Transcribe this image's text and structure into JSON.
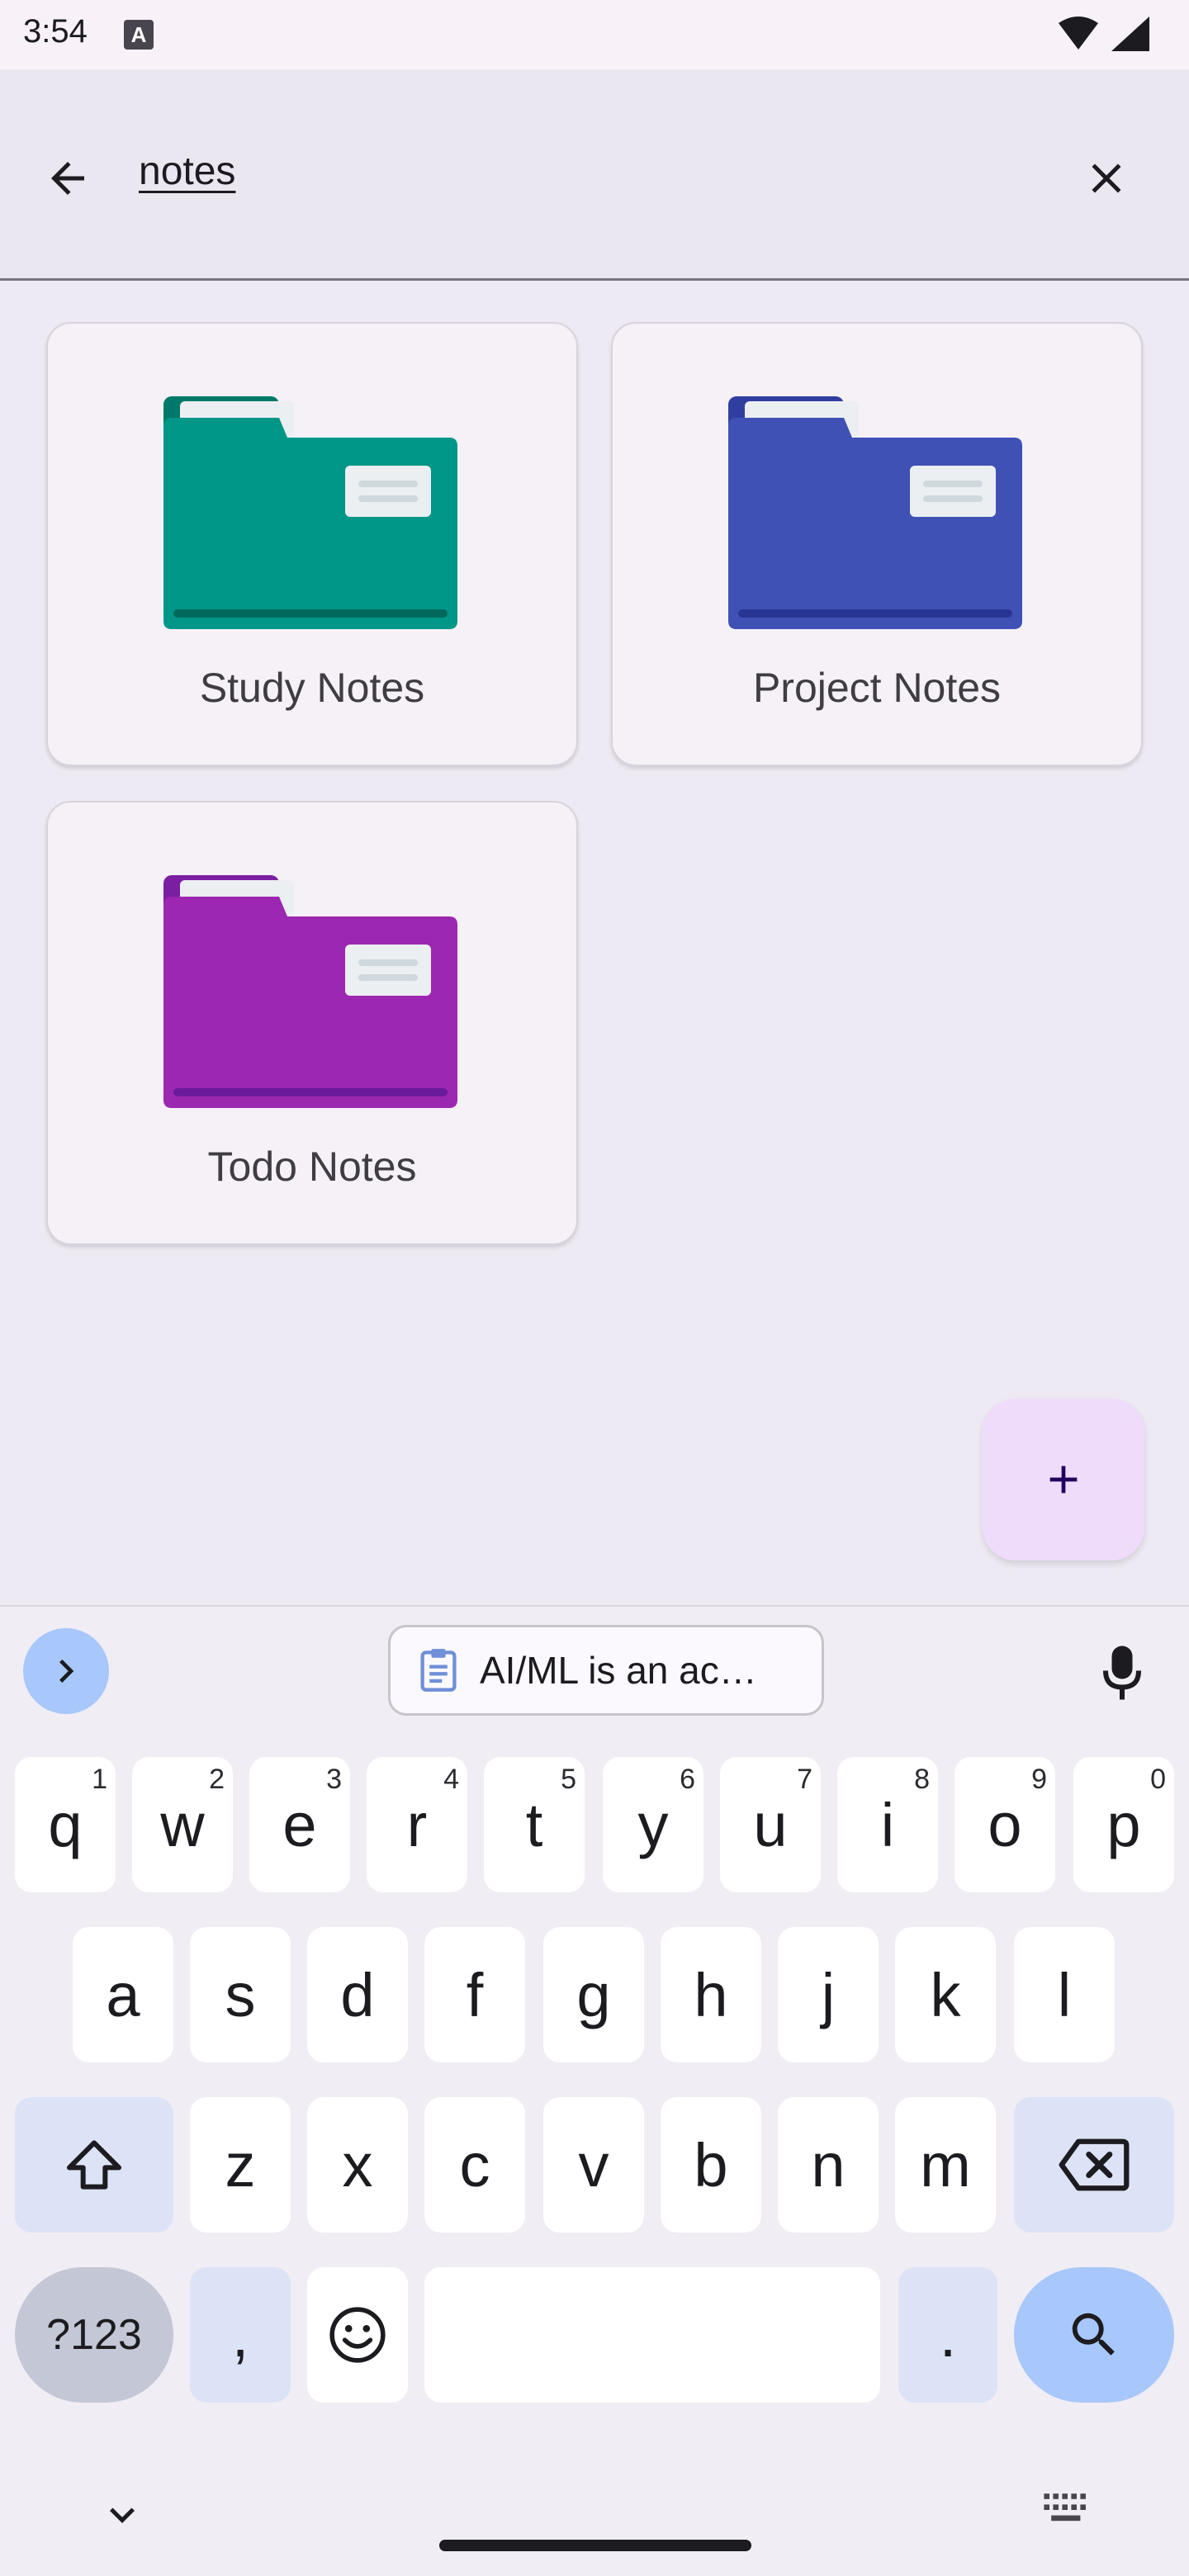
{
  "status_bar": {
    "time": "3:54",
    "notification_icon": "A"
  },
  "search": {
    "query": "notes"
  },
  "folders": [
    {
      "name": "Study Notes",
      "color": "#009688",
      "tab_color": "#00796b",
      "line_color": "#00695c"
    },
    {
      "name": "Project Notes",
      "color": "#3f51b5",
      "tab_color": "#303f9f",
      "line_color": "#283593"
    },
    {
      "name": "Todo Notes",
      "color": "#9c27b0",
      "tab_color": "#7b1fa2",
      "line_color": "#6a1b9a"
    }
  ],
  "keyboard": {
    "clipboard_text": "AI/ML is an ac…",
    "row1": [
      {
        "key": "q",
        "hint": "1"
      },
      {
        "key": "w",
        "hint": "2"
      },
      {
        "key": "e",
        "hint": "3"
      },
      {
        "key": "r",
        "hint": "4"
      },
      {
        "key": "t",
        "hint": "5"
      },
      {
        "key": "y",
        "hint": "6"
      },
      {
        "key": "u",
        "hint": "7"
      },
      {
        "key": "i",
        "hint": "8"
      },
      {
        "key": "o",
        "hint": "9"
      },
      {
        "key": "p",
        "hint": "0"
      }
    ],
    "row2": [
      "a",
      "s",
      "d",
      "f",
      "g",
      "h",
      "j",
      "k",
      "l"
    ],
    "row3": [
      "z",
      "x",
      "c",
      "v",
      "b",
      "n",
      "m"
    ],
    "sym_label": "?123",
    "comma": ",",
    "period": "."
  }
}
